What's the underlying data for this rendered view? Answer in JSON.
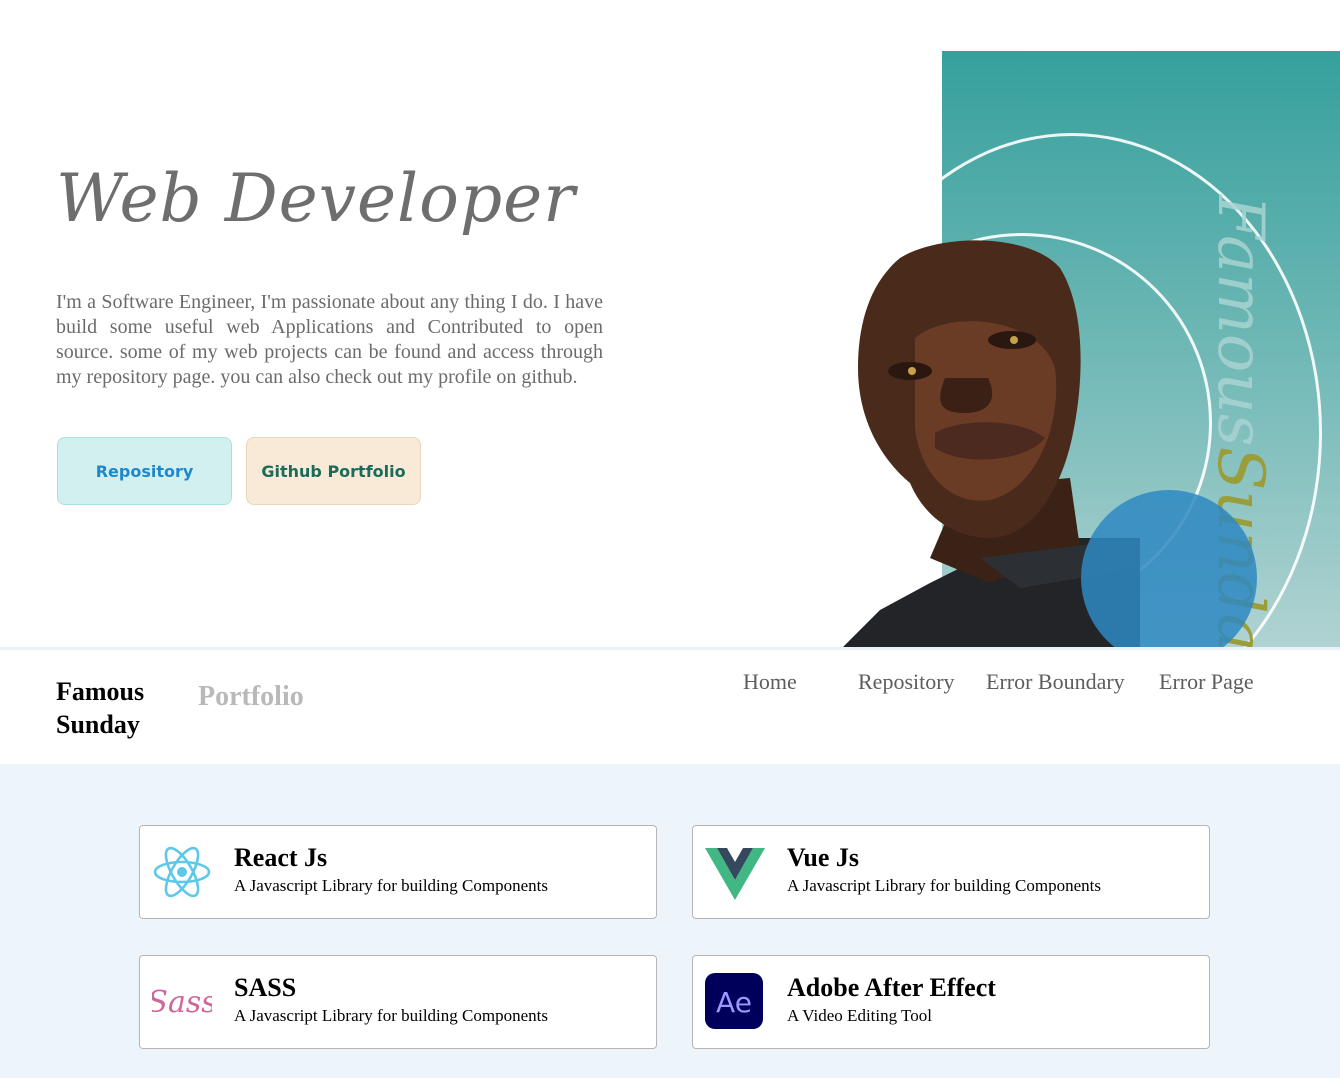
{
  "hero": {
    "title": "Web Developer",
    "description": "I'm a Software Engineer, I'm passionate about any thing I do. I have build some useful web Applications and Contributed to open source. some of my web projects can be found and access through my repository page. you can also check out my profile on github.",
    "buttons": {
      "repository": "Repository",
      "github": "Github Portfolio"
    },
    "vertical_name": {
      "first": "Famous",
      "last": "Sunday"
    },
    "colors": {
      "teal": "#36a09c",
      "circle_blue": "#2e88c2",
      "name_olive": "#9a9d3a"
    }
  },
  "navbar": {
    "brand": "Famous Sunday",
    "brand_sub": "Portfolio",
    "links": [
      "Home",
      "Repository",
      "Error Boundary",
      "Error Page"
    ]
  },
  "skills": [
    {
      "icon": "react-icon",
      "title": "React Js",
      "desc": "A Javascript Library for building Components"
    },
    {
      "icon": "vue-icon",
      "title": "Vue Js",
      "desc": "A Javascript Library for building Components"
    },
    {
      "icon": "sass-icon",
      "title": "SASS",
      "desc": "A Javascript Library for building Components"
    },
    {
      "icon": "after-effects-icon",
      "title": "Adobe After Effect",
      "desc": "A Video Editing Tool"
    }
  ]
}
